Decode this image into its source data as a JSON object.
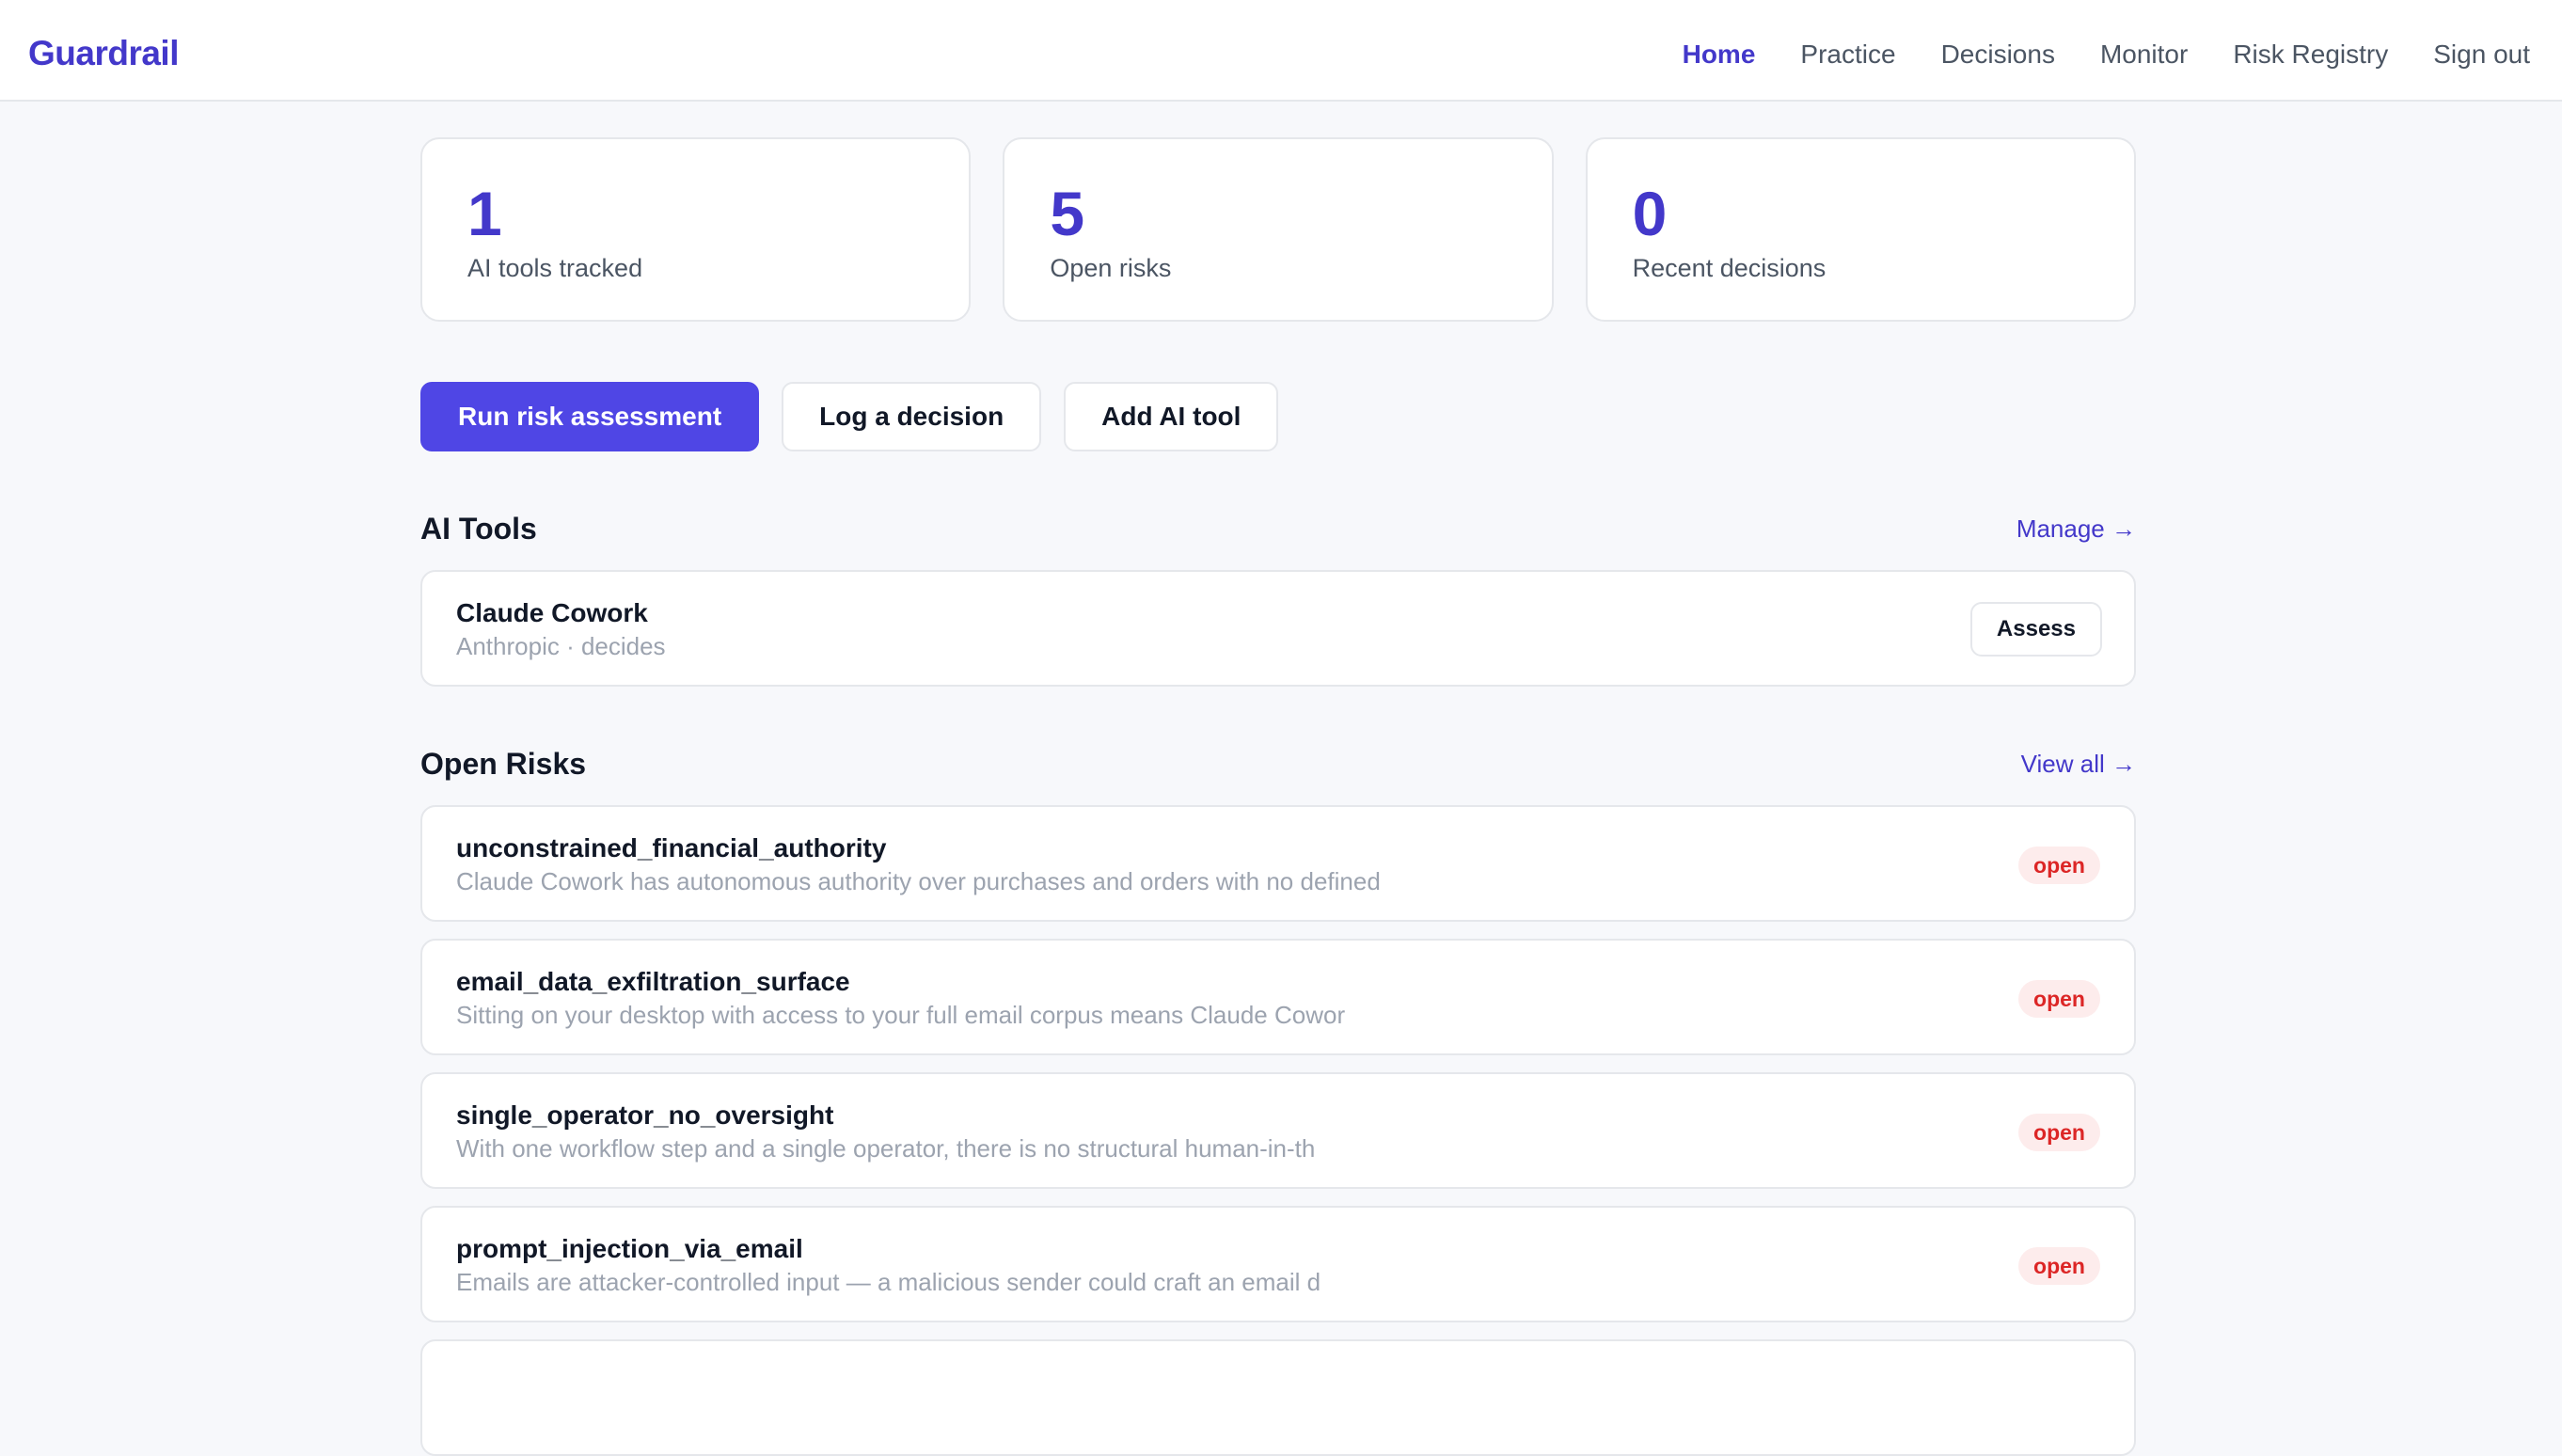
{
  "brand": "Guardrail",
  "nav": [
    {
      "label": "Home",
      "active": true
    },
    {
      "label": "Practice",
      "active": false
    },
    {
      "label": "Decisions",
      "active": false
    },
    {
      "label": "Monitor",
      "active": false
    },
    {
      "label": "Risk Registry",
      "active": false
    },
    {
      "label": "Sign out",
      "active": false
    }
  ],
  "stats": [
    {
      "value": "1",
      "label": "AI tools tracked"
    },
    {
      "value": "5",
      "label": "Open risks"
    },
    {
      "value": "0",
      "label": "Recent decisions"
    }
  ],
  "actions": {
    "run_assessment": "Run risk assessment",
    "log_decision": "Log a decision",
    "add_tool": "Add AI tool"
  },
  "ai_tools": {
    "title": "AI Tools",
    "link": "Manage →",
    "items": [
      {
        "name": "Claude Cowork",
        "subtitle": "Anthropic · decides",
        "action": "Assess"
      }
    ]
  },
  "open_risks": {
    "title": "Open Risks",
    "link": "View all →",
    "items": [
      {
        "name": "unconstrained_financial_authority",
        "description": "Claude Cowork has autonomous authority over purchases and orders with no defined",
        "status": "open"
      },
      {
        "name": "email_data_exfiltration_surface",
        "description": "Sitting on your desktop with access to your full email corpus means Claude Cowor",
        "status": "open"
      },
      {
        "name": "single_operator_no_oversight",
        "description": "With one workflow step and a single operator, there is no structural human-in-th",
        "status": "open"
      },
      {
        "name": "prompt_injection_via_email",
        "description": "Emails are attacker-controlled input — a malicious sender could craft an email d",
        "status": "open"
      }
    ]
  },
  "colors": {
    "accent": "#4f46e5",
    "brand": "#4338ca",
    "badge_bg": "#fdecec",
    "badge_text": "#dc2626",
    "page_bg": "#f7f8fb"
  }
}
